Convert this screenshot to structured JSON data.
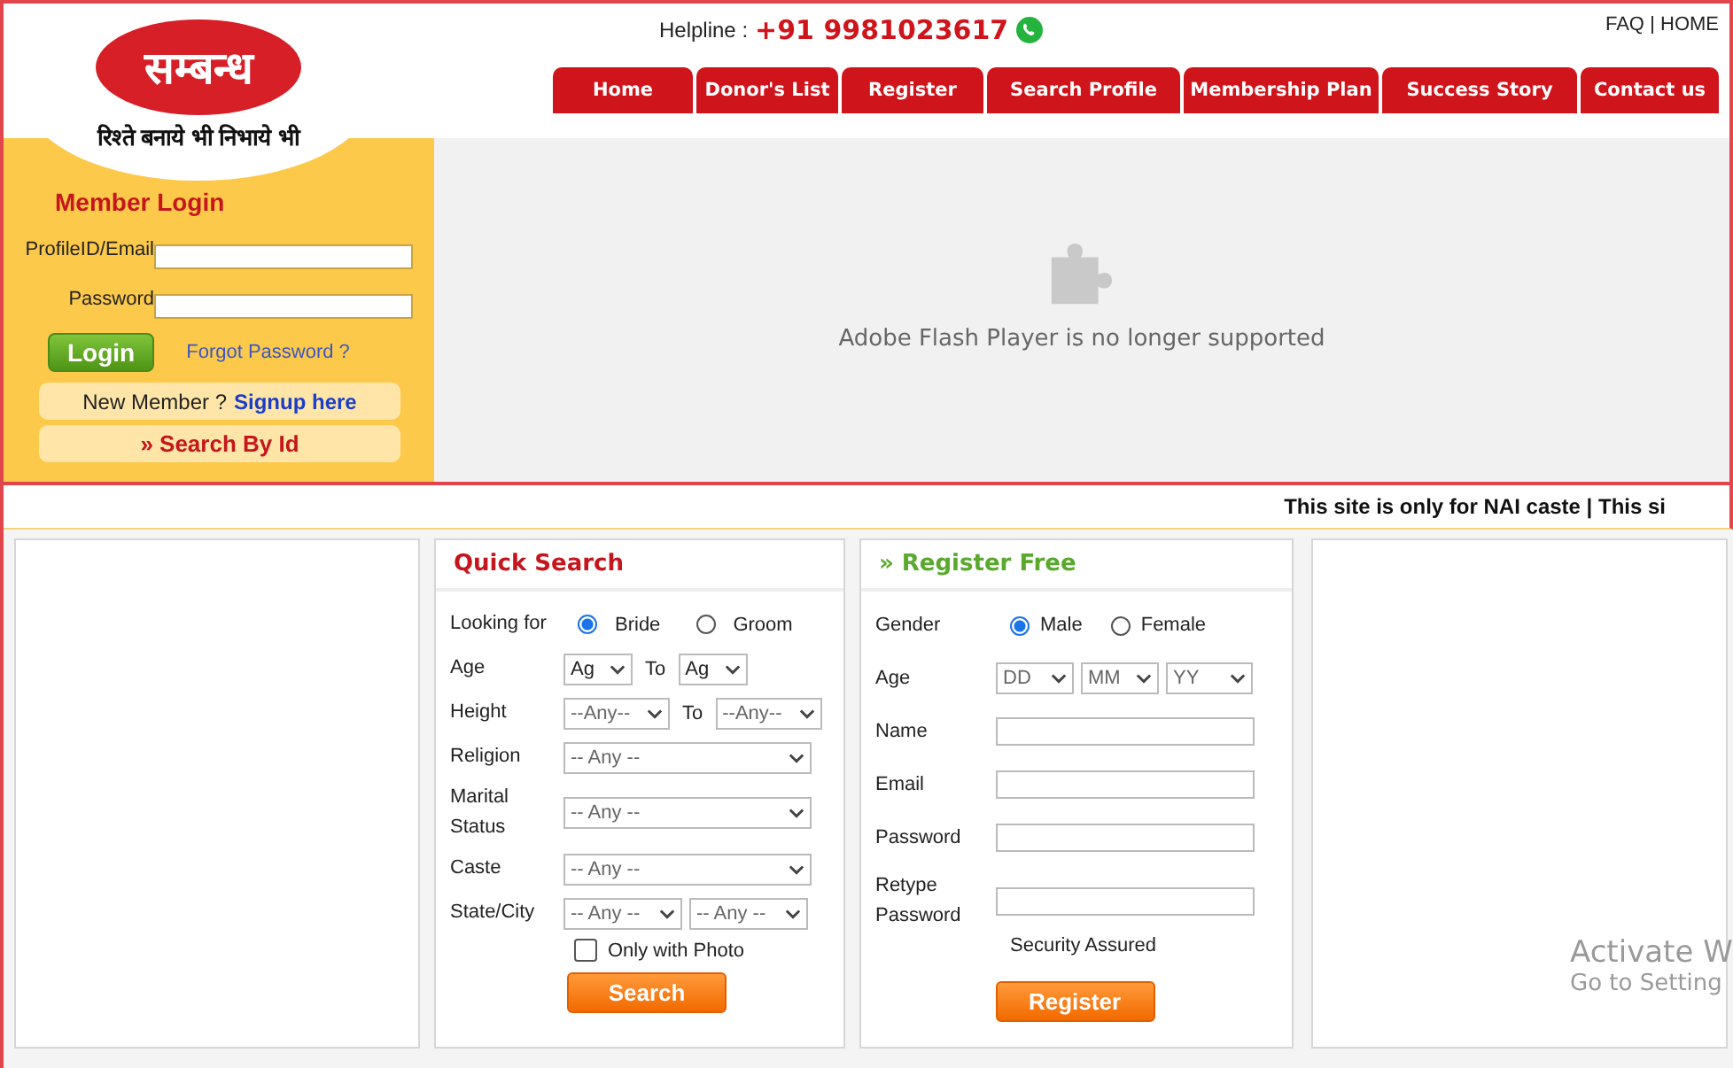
{
  "logo": {
    "title": "सम्बन्ध",
    "tagline": "रिश्ते बनाये भी निभाये भी"
  },
  "helpline": {
    "label": "Helpline :",
    "number": "+91 9981023617"
  },
  "top_links": [
    "FAQ",
    "HOME"
  ],
  "nav": [
    "Home",
    "Donor's List",
    "Register",
    "Search Profile",
    "Membership Plan",
    "Success Story",
    "Contact us"
  ],
  "login": {
    "title": "Member Login",
    "fields": [
      {
        "label": "ProfileID/Email"
      },
      {
        "label": "Password"
      }
    ],
    "button": "Login",
    "forgot": "Forgot Password ?",
    "new_member": "New Member ?",
    "signup": "Signup here",
    "search_by_id": "» Search By Id"
  },
  "flash": {
    "message": "Adobe Flash Player is no longer supported"
  },
  "ticker": "This site is only for NAI caste | This si",
  "quick_search": {
    "title": "Quick Search",
    "looking_for": {
      "label": "Looking for",
      "options": [
        {
          "label": "Bride",
          "selected": true
        },
        {
          "label": "Groom",
          "selected": false
        }
      ]
    },
    "rows": [
      {
        "kind": "range",
        "label": "Age",
        "from": "Ag",
        "to_label": "To",
        "to": "Ag"
      },
      {
        "kind": "range",
        "label": "Height",
        "from": "--Any--",
        "to_label": "To",
        "to": "--Any--"
      },
      {
        "kind": "single",
        "label": "Religion",
        "value": "-- Any --"
      },
      {
        "kind": "single",
        "label": "Marital Status",
        "value": "-- Any --"
      },
      {
        "kind": "single",
        "label": "Caste",
        "value": "-- Any --"
      },
      {
        "kind": "pair",
        "label": "State/City",
        "from": "-- Any --",
        "to": "-- Any --"
      }
    ],
    "photo_only": {
      "label": "Only with Photo",
      "checked": false
    },
    "button": "Search"
  },
  "register": {
    "title": "» Register Free",
    "gender": {
      "label": "Gender",
      "options": [
        {
          "label": "Male",
          "selected": true
        },
        {
          "label": "Female",
          "selected": false
        }
      ]
    },
    "age": {
      "label": "Age",
      "selects": [
        "DD",
        "MM",
        "YY"
      ]
    },
    "fields": [
      {
        "label": "Name"
      },
      {
        "label": "Email"
      },
      {
        "label": "Password"
      },
      {
        "label": "Retype Password"
      }
    ],
    "note": "Security Assured",
    "button": "Register"
  },
  "os_notice": {
    "title": "Activate W",
    "subtitle": "Go to Setting"
  }
}
